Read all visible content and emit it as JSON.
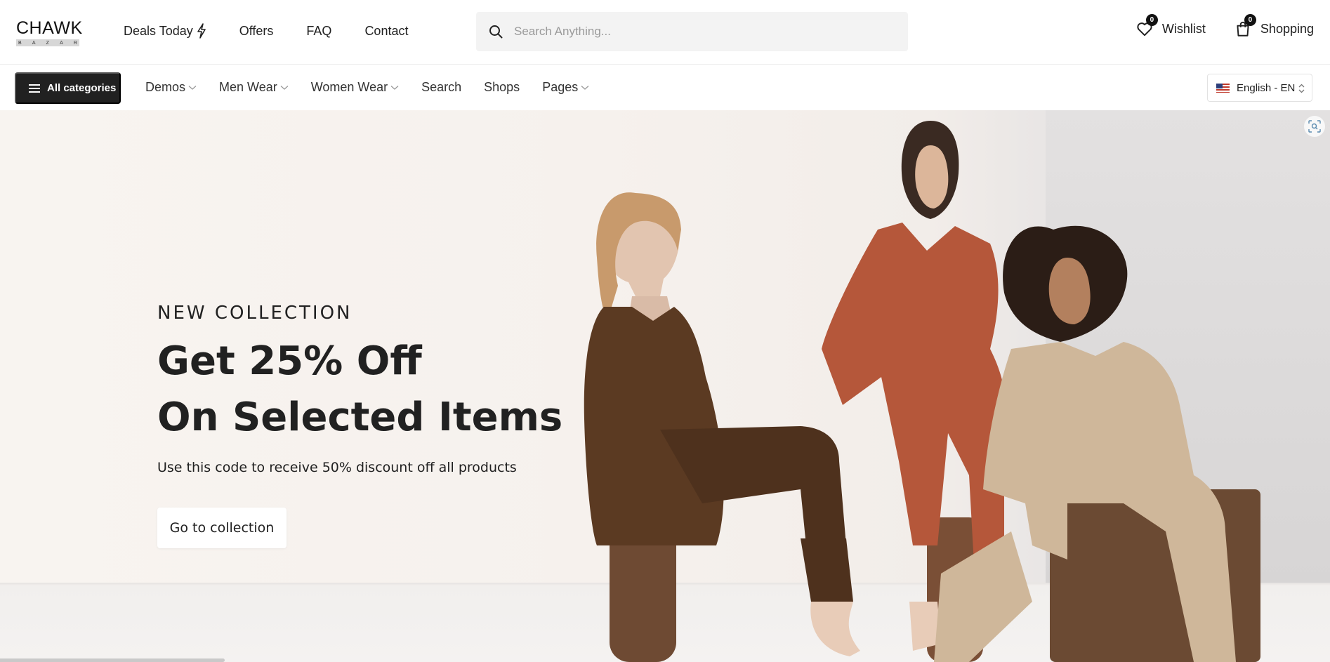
{
  "header": {
    "logo": {
      "main": "CHAWK",
      "sub": [
        "B",
        "A",
        "Z",
        "A",
        "R"
      ]
    },
    "nav": [
      {
        "label": "Deals Today",
        "icon": "lightning-icon"
      },
      {
        "label": "Offers"
      },
      {
        "label": "FAQ"
      },
      {
        "label": "Contact"
      }
    ],
    "search": {
      "placeholder": "Search Anything...",
      "value": ""
    },
    "wishlist": {
      "label": "Wishlist",
      "count": "0",
      "icon": "heart-icon"
    },
    "cart": {
      "label": "Shopping",
      "count": "0",
      "icon": "shopping-bag-icon"
    }
  },
  "category_bar": {
    "all_categories": "All categories",
    "links": [
      {
        "label": "Demos",
        "has_dropdown": true
      },
      {
        "label": "Men Wear",
        "has_dropdown": true
      },
      {
        "label": "Women Wear",
        "has_dropdown": true
      },
      {
        "label": "Search",
        "has_dropdown": false
      },
      {
        "label": "Shops",
        "has_dropdown": false
      },
      {
        "label": "Pages",
        "has_dropdown": true
      }
    ],
    "language": "English - EN"
  },
  "hero": {
    "eyebrow": "NEW COLLECTION",
    "headline_line1": "Get 25% Off",
    "headline_line2": "On Selected Items",
    "subtitle": "Use this code to receive 50% discount off all products",
    "cta": "Go to collection"
  },
  "colors": {
    "dark": "#212121",
    "hero_bg": "#f6f1ed",
    "brown_suit": "#5b3a22",
    "rust_suit": "#b5573a",
    "beige_suit": "#cfb79a"
  }
}
